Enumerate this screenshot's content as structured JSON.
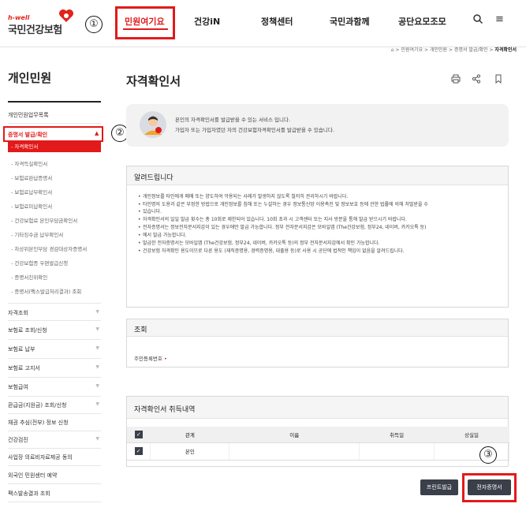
{
  "header": {
    "logo_top": "h-well",
    "logo_name": "국민건강보험",
    "nav": [
      "민원여기요",
      "건강iN",
      "정책센터",
      "국민과함께",
      "공단요모조모"
    ],
    "search_icon": "🔍",
    "menu_icon": "≡"
  },
  "markers": [
    "①",
    "②",
    "③"
  ],
  "breadcrumb": {
    "home": "⌂",
    "items": [
      "민원여기요",
      "개인민원",
      "증명서 발급/확인"
    ],
    "current": "자격확인서",
    "sep": ">"
  },
  "sidebar": {
    "title": "개인민원",
    "top_item": "개인민원업무목록",
    "group": "증명서 발급/확인",
    "active": "- 자격확인서",
    "subs": [
      "- 자격득실확인서",
      "- 보험료완납증명서",
      "- 보험료납부확인서",
      "- 보험료미납확인서",
      "- 건강보험료 본인부담금확인서",
      "- 기타징수금 납부확인서",
      "- 차상위본인부담 경감대상자증명서",
      "- 건강보험증 우편발급신청",
      "- 증명서진위확인",
      "- 증명서(팩스발급처리결과) 조회"
    ],
    "items": [
      "자격조회",
      "보험료 조회/신청",
      "보험료 납부",
      "보험료 고지서",
      "보험급여",
      "환급금(지원금) 조회/신청",
      "채권 추심(전부) 정보 신청",
      "건강검진",
      "사업장 의료비자료제공 동의",
      "외국인 민원센터 예약",
      "팩스발송결과 조회"
    ]
  },
  "main": {
    "title": "자격확인서",
    "icons": {
      "print": "🖶",
      "share": "⟨",
      "bookmark": "⊓"
    },
    "info": [
      "본인의 자격확인서를 발급받을 수 있는 서비스 입니다.",
      "가입자 또는 가입자였던 자의 건강보험자격확인서를 발급받을 수 있습니다."
    ]
  },
  "notice": {
    "title": "알려드립니다",
    "items": [
      "개인정보를 타인에게 매매 또는 양도하여 악용되는 사례가 발생하지 않도록 철저히 관리하시기 바랍니다.",
      "타인명의 도용과 같은 부정한 방법으로 개인정보를 침해 또는 누설하는 경우 정보통신망 이용촉진 및 정보보호 등에 관한 법률에 의해 처벌받을 수",
      "있습니다.",
      "자격확인서의 일일 발급 횟수는 총 10회로 제한되어 있습니다. 10회 초과 시 고객센터 또는 지사 방문을 통해 발급 받으시기 바랍니다.",
      "전자증명서는 정보전자문서지갑이 있는 경우에만 발급 가능합니다. 정부 전자문서지갑은 모바일앱 (The건강보험, 정부24, 네이버, 카카오톡 등)",
      "에서 발급 가능합니다.",
      "발급한 전자증명서는 모바일앱 (The건강보험, 정부24, 네이버, 카카오톡 등)의 정부 전자문서지갑에서 확인 가능합니다.",
      "건강보험 자격확인 용도이므로 다른 용도 (재직증명용, 경력증명용, 대출용 등)로 사용 시 공단에 법적인 책임이 없음을 알려드립니다."
    ]
  },
  "lookup": {
    "title": "조회",
    "field_label": "주민등록번호",
    "required": "•"
  },
  "history": {
    "title": "자격확인서 취득내역",
    "columns": [
      "관계",
      "이름",
      "취득일",
      "상실일"
    ],
    "rows": [
      {
        "relation": "본인",
        "name": "",
        "acquired": "",
        "lost": ""
      }
    ],
    "check": "✓"
  },
  "buttons": {
    "print": "프린트발급",
    "electronic": "전자증명서"
  },
  "colors": {
    "accent": "#e21a1a",
    "dark_button": "#3a3f4a"
  }
}
